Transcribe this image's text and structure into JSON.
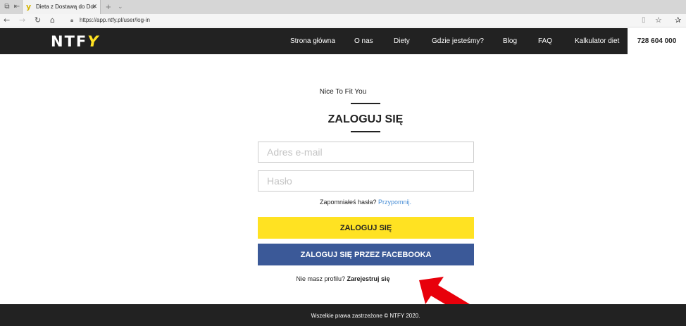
{
  "browser": {
    "tab": {
      "title": "Dieta z Dostawą do Dor",
      "favicon": "y",
      "close": "✕"
    },
    "new_tab": "+",
    "url": "https://app.ntfy.pl/user/log-in",
    "icons": {
      "tab_switch": "tab-switcher-icon",
      "back": "←",
      "forward": "→",
      "refresh": "↻",
      "home": "⌂",
      "lock": "🔒",
      "reading_view": "▯",
      "favorite": "☆",
      "favorites_bar": "✰"
    }
  },
  "header": {
    "logo": {
      "text": "NTF",
      "accent": "Y"
    },
    "nav": [
      "Strona główna",
      "O nas",
      "Diety",
      "Gdzie jesteśmy?",
      "Blog",
      "FAQ",
      "Kalkulator diet"
    ],
    "phone": "728 604 000"
  },
  "login": {
    "tagline": "Nice To Fit You",
    "heading": "ZALOGUJ SIĘ",
    "email_placeholder": "Adres e-mail",
    "password_placeholder": "Hasło",
    "forgot_text": "Zapomniałeś hasła?",
    "forgot_link": "Przypomnij.",
    "login_button": "ZALOGUJ SIĘ",
    "facebook_button": "ZALOGUJ SIĘ PRZEZ FACEBOOKA",
    "no_profile_text": "Nie masz profilu?",
    "register_link": "Zarejestruj się"
  },
  "footer": {
    "copyright": "Wszelkie prawa zastrzeżone © NTFY 2020."
  },
  "colors": {
    "brand_yellow": "#ffe222",
    "facebook_blue": "#3b5998",
    "dark": "#222222",
    "link_blue": "#4a8fd6",
    "arrow_red": "#e8000b"
  }
}
